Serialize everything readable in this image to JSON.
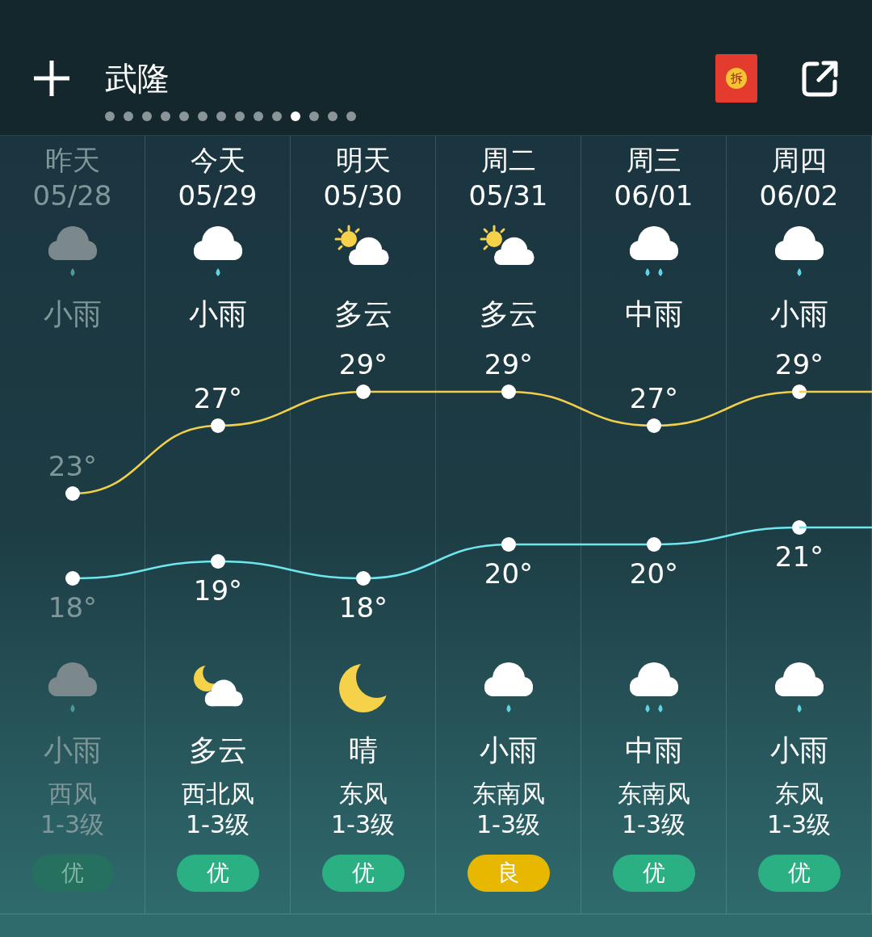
{
  "header": {
    "title": "武隆",
    "badge_text": "拆",
    "pages": [
      {
        "selected": false
      },
      {
        "selected": false
      },
      {
        "selected": false
      },
      {
        "selected": false
      },
      {
        "selected": false
      },
      {
        "selected": false
      },
      {
        "selected": false
      },
      {
        "selected": false
      },
      {
        "selected": false
      },
      {
        "selected": false
      },
      {
        "selected": true
      },
      {
        "selected": false
      },
      {
        "selected": false
      },
      {
        "selected": false
      }
    ]
  },
  "days": [
    {
      "label": "昨天",
      "date": "05/28",
      "past": true,
      "day": {
        "kind": "light_rain",
        "weather": "小雨"
      },
      "night": {
        "kind": "light_rain",
        "weather": "小雨"
      },
      "wind_dir": "西风",
      "wind_level": "1-3级",
      "aqi": {
        "text": "优",
        "color": "#25705e"
      }
    },
    {
      "label": "今天",
      "date": "05/29",
      "past": false,
      "day": {
        "kind": "light_rain",
        "weather": "小雨"
      },
      "night": {
        "kind": "cloudy_moon",
        "weather": "多云"
      },
      "wind_dir": "西北风",
      "wind_level": "1-3级",
      "aqi": {
        "text": "优",
        "color": "#2bb084"
      }
    },
    {
      "label": "明天",
      "date": "05/30",
      "past": false,
      "day": {
        "kind": "cloudy_sun",
        "weather": "多云"
      },
      "night": {
        "kind": "moon",
        "weather": "晴"
      },
      "wind_dir": "东风",
      "wind_level": "1-3级",
      "aqi": {
        "text": "优",
        "color": "#2bb084"
      }
    },
    {
      "label": "周二",
      "date": "05/31",
      "past": false,
      "day": {
        "kind": "cloudy_sun",
        "weather": "多云"
      },
      "night": {
        "kind": "light_rain",
        "weather": "小雨"
      },
      "wind_dir": "东南风",
      "wind_level": "1-3级",
      "aqi": {
        "text": "良",
        "color": "#e8b800"
      }
    },
    {
      "label": "周三",
      "date": "06/01",
      "past": false,
      "day": {
        "kind": "moderate_rain",
        "weather": "中雨"
      },
      "night": {
        "kind": "moderate_rain",
        "weather": "中雨"
      },
      "wind_dir": "东南风",
      "wind_level": "1-3级",
      "aqi": {
        "text": "优",
        "color": "#2bb084"
      }
    },
    {
      "label": "周四",
      "date": "06/02",
      "past": false,
      "day": {
        "kind": "light_rain",
        "weather": "小雨"
      },
      "night": {
        "kind": "light_rain",
        "weather": "小雨"
      },
      "wind_dir": "东风",
      "wind_level": "1-3级",
      "aqi": {
        "text": "优",
        "color": "#2bb084"
      }
    }
  ],
  "chart_data": {
    "type": "line",
    "series": [
      {
        "color": "#f0cf4a",
        "marker": "circle",
        "values": [
          23,
          27,
          29,
          29,
          27,
          29
        ],
        "value_labels": [
          "23°",
          "27°",
          "29°",
          "29°",
          "27°",
          "29°"
        ]
      },
      {
        "color": "#6fe6ee",
        "marker": "circle",
        "values": [
          18,
          19,
          18,
          20,
          20,
          21
        ],
        "value_labels": [
          "18°",
          "19°",
          "18°",
          "20°",
          "20°",
          "21°"
        ]
      }
    ]
  }
}
